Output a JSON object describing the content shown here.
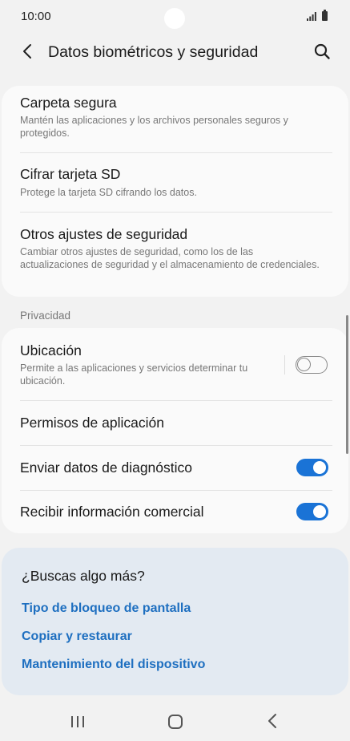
{
  "status_bar": {
    "time": "10:00",
    "icons": [
      "signal-icon",
      "battery-icon"
    ]
  },
  "header": {
    "title": "Datos biométricos y seguridad",
    "icons": [
      "back-icon",
      "search-icon"
    ]
  },
  "security_items": [
    {
      "title": "Carpeta segura",
      "subtitle": "Mantén las aplicaciones y los archivos personales seguros y protegidos."
    },
    {
      "title": "Cifrar tarjeta SD",
      "subtitle": "Protege la tarjeta SD cifrando los datos."
    },
    {
      "title": "Otros ajustes de seguridad",
      "subtitle": "Cambiar otros ajustes de seguridad, como los de las actualizaciones de seguridad y el almacenamiento de credenciales."
    }
  ],
  "privacy": {
    "header": "Privacidad",
    "items": [
      {
        "title": "Ubicación",
        "subtitle": "Permite a las aplicaciones y servicios determinar tu ubicación.",
        "toggle": false
      },
      {
        "title": "Permisos de aplicación"
      },
      {
        "title": "Enviar datos de diagnóstico",
        "toggle": true
      },
      {
        "title": "Recibir información comercial",
        "toggle": true
      }
    ]
  },
  "suggestions": {
    "title": "¿Buscas algo más?",
    "links": [
      "Tipo de bloqueo de pantalla",
      "Copiar y restaurar",
      "Mantenimiento del dispositivo"
    ]
  },
  "nav_bar": {
    "icons": [
      "recents-icon",
      "home-icon",
      "back-nav-icon"
    ]
  },
  "colors": {
    "accent": "#1a73d6",
    "link": "#1e6fc0",
    "background": "#f2f2f2",
    "card": "#fafafa",
    "suggest_card": "#e3eaf2"
  }
}
